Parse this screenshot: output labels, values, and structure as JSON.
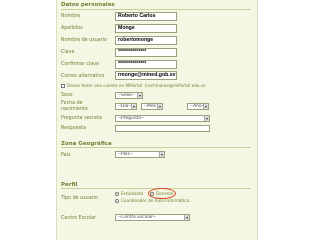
{
  "sections": {
    "personal": "Datos personales",
    "geo": "Zona Geográfica",
    "profile": "Perfil"
  },
  "fields": {
    "nombre": {
      "label": "Nombre",
      "value": "Roberto Carlos"
    },
    "apellidos": {
      "label": "Apellidos",
      "value": "Monge"
    },
    "usuario": {
      "label": "Nombre de usuario",
      "value": "robertomonge"
    },
    "clave": {
      "label": "Clave",
      "value": "**************"
    },
    "confirmar": {
      "label": "Confirmar clave",
      "value": "**************"
    },
    "correo": {
      "label": "Correo alternativo",
      "value": "rmonge@mined.gob.sv"
    },
    "cuenta_check": {
      "label": "Deseo tener una cuenta en MiPortal. (rachmaine@miPortal.edu.sv"
    },
    "sexo": {
      "label": "Sexo",
      "value": "--Sexo--"
    },
    "nacimiento": {
      "label": "Fecha de nacimiento",
      "dia": "--Día--",
      "mes": "--Mes--",
      "anio": "--Año--"
    },
    "pregunta": {
      "label": "Pregunta secreta",
      "value": "--Pregunta--"
    },
    "respuesta": {
      "label": "Respuesta",
      "value": ""
    },
    "pais": {
      "label": "País",
      "value": "--País--"
    },
    "tipo": {
      "label": "Tipo de usuario",
      "options": [
        "Estudiante",
        "Docente",
        "Coordinador de Aula Informática"
      ],
      "highlighted": "Docente"
    },
    "centro": {
      "label": "Centro Escolar",
      "value": "--Centro Escolar--"
    }
  },
  "colors": {
    "accent": "#6b7f33",
    "panel": "#f5f7e4",
    "highlight_circle": "#d84a2a"
  }
}
